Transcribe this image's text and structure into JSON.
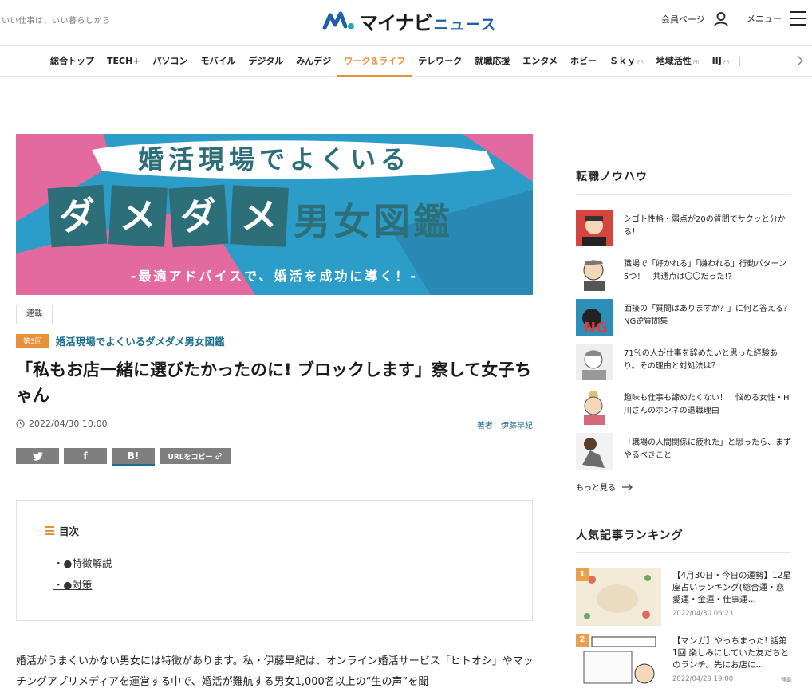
{
  "header": {
    "tagline": "いい仕事は、いい暮らしから",
    "logo_main": "マイナビ",
    "logo_sub": "ニュース",
    "member_label": "会員ページ",
    "menu_label": "メニュー"
  },
  "nav": {
    "items": [
      "総合トップ",
      "TECH+",
      "パソコン",
      "モバイル",
      "デジタル",
      "みんデジ",
      "ワーク＆ライフ",
      "テレワーク",
      "就職応援",
      "エンタメ",
      "ホビー",
      "Ｓｋｙ",
      "地域活性",
      "IIJ"
    ],
    "pr_label": "PR",
    "active": "ワーク＆ライフ"
  },
  "banner": {
    "line1": "婚活現場でよくいる",
    "line2_tiles": [
      "ダ",
      "メ",
      "ダ",
      "メ"
    ],
    "line2_rest": "男女図鑑",
    "line3": "-最適アドバイスで、婚活を成功に導く！-"
  },
  "article": {
    "category": "連載",
    "issue_badge": "第3回",
    "series_title": "婚活現場でよくいるダメダメ男女図鑑",
    "title": "「私もお店一緒に選びたかったのに! ブロックします」察して女子ちゃん",
    "date": "2022/04/30 10:00",
    "author": "著者：伊藤早紀",
    "share": {
      "hatena": "B!",
      "url_copy": "URLをコピー"
    },
    "toc": {
      "heading": "目次",
      "items": [
        "・●特徴解説",
        "・●対策"
      ]
    },
    "lead": "婚活がうまくいかない男女には特徴があります。私・伊藤早紀は、オンライン婚活サービス「ヒトオシ」やマッチングアプリメディアを運営する中で、婚活が難航する男女1,000名以上の“生の声”を聞"
  },
  "sidebar": {
    "career": {
      "heading": "転職ノウハウ",
      "items": [
        "シゴト性格・弱点が20の質問でサクッと分かる！",
        "職場で「好かれる」「嫌われる」行動パターン5つ！　共通点は〇〇だった!?",
        "面接の「質問はありますか？」に何と答える？　NG逆質問集",
        "71％の人が仕事を辞めたいと思った経験あり。その理由と対処法は？",
        "趣味も仕事も諦めたくない！　悩める女性・H川さんのホンネの退職理由",
        "「職場の人間関係に疲れた」と思ったら、まずやるべきこと"
      ],
      "more": "もっと見る"
    },
    "ranking": {
      "heading": "人気記事ランキング",
      "items": [
        {
          "rank": "1",
          "title": "【4月30日・今日の運勢】12星座占いランキング(総合運・恋愛運・金運・仕事運…",
          "date": "2022/04/30 06:23",
          "tag": ""
        },
        {
          "rank": "2",
          "title": "【マンガ】やっちまった! 話第1回 楽しみにしていた友だちとのランチ。先にお店に…",
          "date": "2022/04/29 19:00",
          "tag": "連載"
        }
      ]
    }
  },
  "colors": {
    "accent": "#e8913a",
    "link": "#1d6e8e",
    "banner_pink": "#e36a9e",
    "banner_blue": "#2c9cc9",
    "banner_teal": "#2d6f79"
  }
}
